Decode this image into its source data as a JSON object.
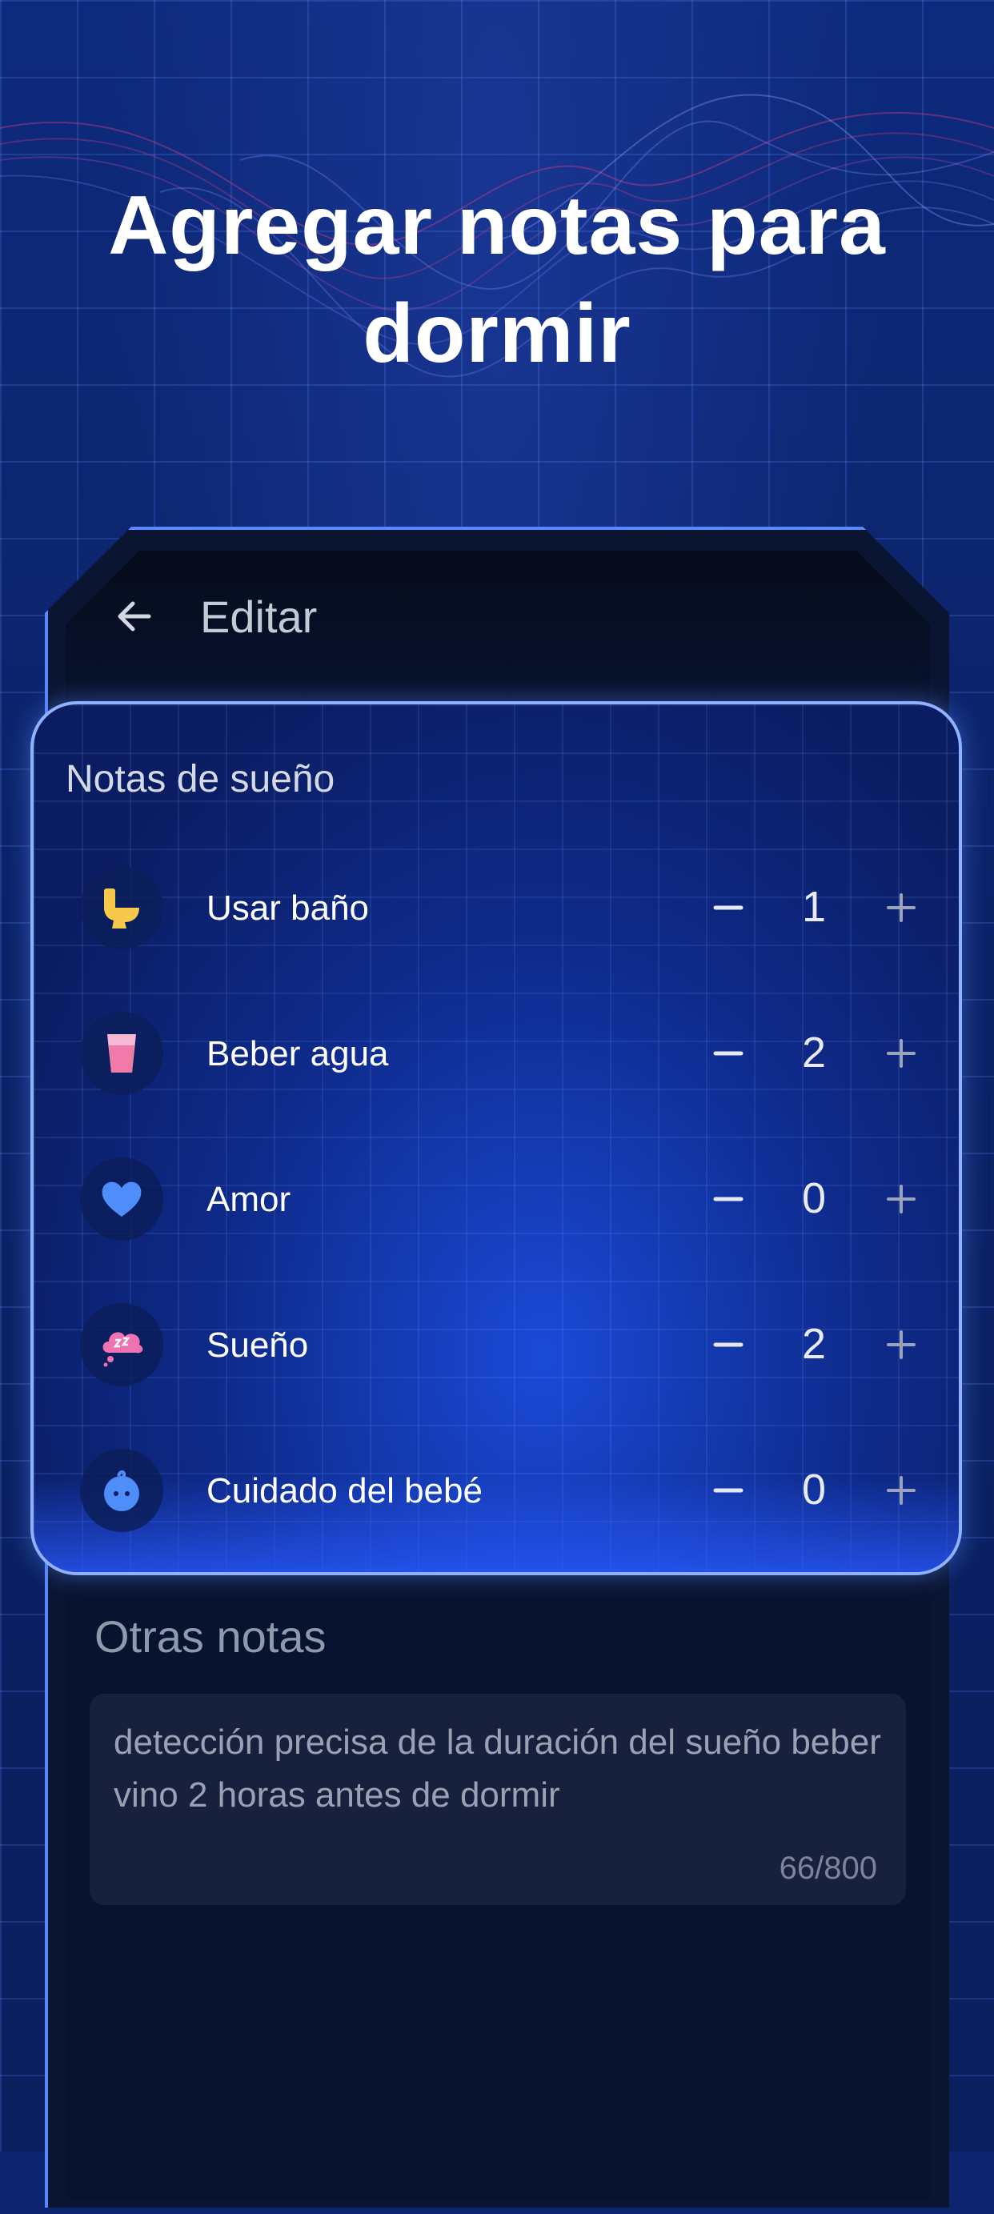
{
  "headline": "Agregar notas para dormir",
  "topbar": {
    "back_icon": "arrow-left-icon",
    "title": "Editar"
  },
  "sleep_notes": {
    "title": "Notas de sueño",
    "items": [
      {
        "label": "Usar baño",
        "count": "1",
        "icon": "toilet-icon",
        "icon_color": "#f7c84a"
      },
      {
        "label": "Beber agua",
        "count": "2",
        "icon": "water-glass-icon",
        "icon_color": "#f07aa8"
      },
      {
        "label": "Amor",
        "count": "0",
        "icon": "heart-icon",
        "icon_color": "#4f8dfb"
      },
      {
        "label": "Sueño",
        "count": "2",
        "icon": "sleep-cloud-icon",
        "icon_color": "#ef72b2"
      },
      {
        "label": "Cuidado del bebé",
        "count": "0",
        "icon": "baby-icon",
        "icon_color": "#4f8dfb"
      }
    ]
  },
  "other_notes": {
    "title": "Otras notas",
    "text": "detección precisa de la duración del sueño beber vino 2 horas antes de dormir",
    "char_count": "66/800"
  },
  "colors": {
    "accent": "#5a86ff",
    "background": "#0d2470",
    "card_border": "#8fb1ff"
  }
}
